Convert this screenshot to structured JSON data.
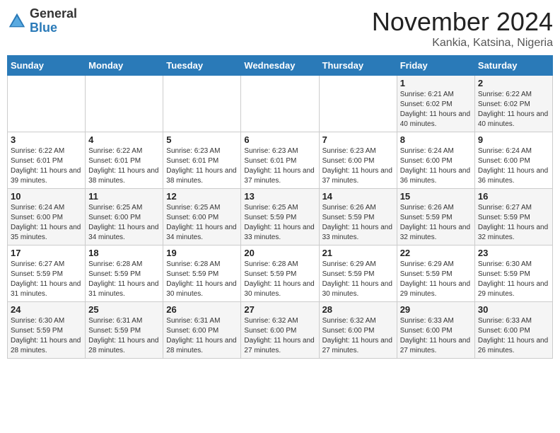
{
  "header": {
    "logo_general": "General",
    "logo_blue": "Blue",
    "month": "November 2024",
    "location": "Kankia, Katsina, Nigeria"
  },
  "days_of_week": [
    "Sunday",
    "Monday",
    "Tuesday",
    "Wednesday",
    "Thursday",
    "Friday",
    "Saturday"
  ],
  "weeks": [
    [
      {
        "day": "",
        "info": ""
      },
      {
        "day": "",
        "info": ""
      },
      {
        "day": "",
        "info": ""
      },
      {
        "day": "",
        "info": ""
      },
      {
        "day": "",
        "info": ""
      },
      {
        "day": "1",
        "info": "Sunrise: 6:21 AM\nSunset: 6:02 PM\nDaylight: 11 hours and 40 minutes."
      },
      {
        "day": "2",
        "info": "Sunrise: 6:22 AM\nSunset: 6:02 PM\nDaylight: 11 hours and 40 minutes."
      }
    ],
    [
      {
        "day": "3",
        "info": "Sunrise: 6:22 AM\nSunset: 6:01 PM\nDaylight: 11 hours and 39 minutes."
      },
      {
        "day": "4",
        "info": "Sunrise: 6:22 AM\nSunset: 6:01 PM\nDaylight: 11 hours and 38 minutes."
      },
      {
        "day": "5",
        "info": "Sunrise: 6:23 AM\nSunset: 6:01 PM\nDaylight: 11 hours and 38 minutes."
      },
      {
        "day": "6",
        "info": "Sunrise: 6:23 AM\nSunset: 6:01 PM\nDaylight: 11 hours and 37 minutes."
      },
      {
        "day": "7",
        "info": "Sunrise: 6:23 AM\nSunset: 6:00 PM\nDaylight: 11 hours and 37 minutes."
      },
      {
        "day": "8",
        "info": "Sunrise: 6:24 AM\nSunset: 6:00 PM\nDaylight: 11 hours and 36 minutes."
      },
      {
        "day": "9",
        "info": "Sunrise: 6:24 AM\nSunset: 6:00 PM\nDaylight: 11 hours and 36 minutes."
      }
    ],
    [
      {
        "day": "10",
        "info": "Sunrise: 6:24 AM\nSunset: 6:00 PM\nDaylight: 11 hours and 35 minutes."
      },
      {
        "day": "11",
        "info": "Sunrise: 6:25 AM\nSunset: 6:00 PM\nDaylight: 11 hours and 34 minutes."
      },
      {
        "day": "12",
        "info": "Sunrise: 6:25 AM\nSunset: 6:00 PM\nDaylight: 11 hours and 34 minutes."
      },
      {
        "day": "13",
        "info": "Sunrise: 6:25 AM\nSunset: 5:59 PM\nDaylight: 11 hours and 33 minutes."
      },
      {
        "day": "14",
        "info": "Sunrise: 6:26 AM\nSunset: 5:59 PM\nDaylight: 11 hours and 33 minutes."
      },
      {
        "day": "15",
        "info": "Sunrise: 6:26 AM\nSunset: 5:59 PM\nDaylight: 11 hours and 32 minutes."
      },
      {
        "day": "16",
        "info": "Sunrise: 6:27 AM\nSunset: 5:59 PM\nDaylight: 11 hours and 32 minutes."
      }
    ],
    [
      {
        "day": "17",
        "info": "Sunrise: 6:27 AM\nSunset: 5:59 PM\nDaylight: 11 hours and 31 minutes."
      },
      {
        "day": "18",
        "info": "Sunrise: 6:28 AM\nSunset: 5:59 PM\nDaylight: 11 hours and 31 minutes."
      },
      {
        "day": "19",
        "info": "Sunrise: 6:28 AM\nSunset: 5:59 PM\nDaylight: 11 hours and 30 minutes."
      },
      {
        "day": "20",
        "info": "Sunrise: 6:28 AM\nSunset: 5:59 PM\nDaylight: 11 hours and 30 minutes."
      },
      {
        "day": "21",
        "info": "Sunrise: 6:29 AM\nSunset: 5:59 PM\nDaylight: 11 hours and 30 minutes."
      },
      {
        "day": "22",
        "info": "Sunrise: 6:29 AM\nSunset: 5:59 PM\nDaylight: 11 hours and 29 minutes."
      },
      {
        "day": "23",
        "info": "Sunrise: 6:30 AM\nSunset: 5:59 PM\nDaylight: 11 hours and 29 minutes."
      }
    ],
    [
      {
        "day": "24",
        "info": "Sunrise: 6:30 AM\nSunset: 5:59 PM\nDaylight: 11 hours and 28 minutes."
      },
      {
        "day": "25",
        "info": "Sunrise: 6:31 AM\nSunset: 5:59 PM\nDaylight: 11 hours and 28 minutes."
      },
      {
        "day": "26",
        "info": "Sunrise: 6:31 AM\nSunset: 6:00 PM\nDaylight: 11 hours and 28 minutes."
      },
      {
        "day": "27",
        "info": "Sunrise: 6:32 AM\nSunset: 6:00 PM\nDaylight: 11 hours and 27 minutes."
      },
      {
        "day": "28",
        "info": "Sunrise: 6:32 AM\nSunset: 6:00 PM\nDaylight: 11 hours and 27 minutes."
      },
      {
        "day": "29",
        "info": "Sunrise: 6:33 AM\nSunset: 6:00 PM\nDaylight: 11 hours and 27 minutes."
      },
      {
        "day": "30",
        "info": "Sunrise: 6:33 AM\nSunset: 6:00 PM\nDaylight: 11 hours and 26 minutes."
      }
    ]
  ]
}
